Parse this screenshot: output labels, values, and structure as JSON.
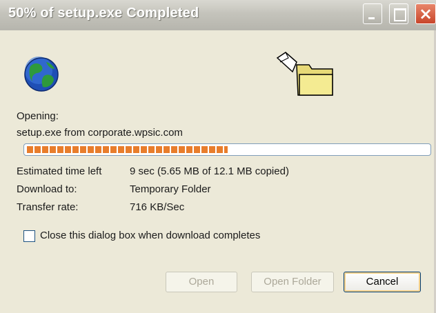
{
  "window": {
    "title": "50% of setup.exe Completed"
  },
  "status": {
    "opening_label": "Opening:",
    "source_text": "setup.exe from corporate.wpsic.com",
    "progress_fraction": 0.5
  },
  "details": {
    "estimated_label": "Estimated time left",
    "estimated_value": "9 sec (5.65 MB of 12.1 MB copied)",
    "download_to_label": "Download to:",
    "download_to_value": "Temporary Folder",
    "transfer_rate_label": "Transfer rate:",
    "transfer_rate_value": "716 KB/Sec"
  },
  "options": {
    "close_when_done_label": "Close this dialog box when download completes",
    "close_when_done_checked": false
  },
  "buttons": {
    "open": "Open",
    "open_folder": "Open Folder",
    "cancel": "Cancel"
  },
  "icons": {
    "globe": "globe-icon",
    "folder": "folder-icon",
    "paper": "document-icon"
  }
}
